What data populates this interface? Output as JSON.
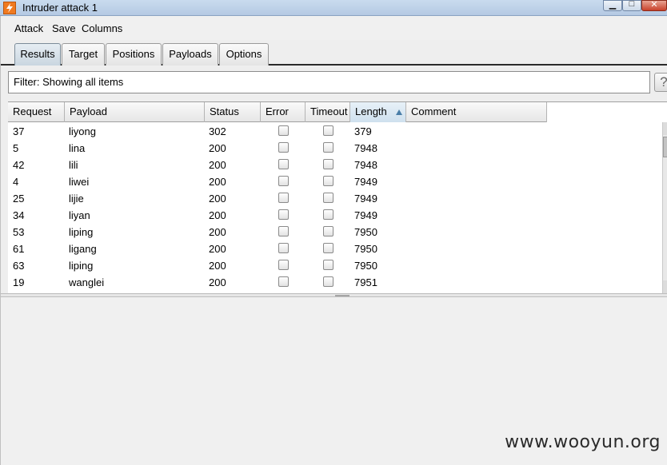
{
  "window": {
    "title": "Intruder attack 1",
    "icon": "burp-lightning-icon",
    "controls": [
      "minimize",
      "maximize",
      "close"
    ]
  },
  "menu": [
    "Attack",
    "Save",
    "Columns"
  ],
  "tabs": [
    {
      "label": "Results",
      "active": true
    },
    {
      "label": "Target",
      "active": false
    },
    {
      "label": "Positions",
      "active": false
    },
    {
      "label": "Payloads",
      "active": false
    },
    {
      "label": "Options",
      "active": false
    }
  ],
  "filter": {
    "text": "Filter: Showing all items",
    "help": "?"
  },
  "table": {
    "columns": [
      "Request",
      "Payload",
      "Status",
      "Error",
      "Timeout",
      "Length",
      "Comment"
    ],
    "sorted_column": "Length",
    "sort_direction": "ascending",
    "rows": [
      {
        "request": "37",
        "payload": "liyong",
        "status": "302",
        "error": false,
        "timeout": false,
        "length": "379",
        "comment": ""
      },
      {
        "request": "5",
        "payload": "lina",
        "status": "200",
        "error": false,
        "timeout": false,
        "length": "7948",
        "comment": ""
      },
      {
        "request": "42",
        "payload": "lili",
        "status": "200",
        "error": false,
        "timeout": false,
        "length": "7948",
        "comment": ""
      },
      {
        "request": "4",
        "payload": "liwei",
        "status": "200",
        "error": false,
        "timeout": false,
        "length": "7949",
        "comment": ""
      },
      {
        "request": "25",
        "payload": "lijie",
        "status": "200",
        "error": false,
        "timeout": false,
        "length": "7949",
        "comment": ""
      },
      {
        "request": "34",
        "payload": "liyan",
        "status": "200",
        "error": false,
        "timeout": false,
        "length": "7949",
        "comment": ""
      },
      {
        "request": "53",
        "payload": "liping",
        "status": "200",
        "error": false,
        "timeout": false,
        "length": "7950",
        "comment": ""
      },
      {
        "request": "61",
        "payload": "ligang",
        "status": "200",
        "error": false,
        "timeout": false,
        "length": "7950",
        "comment": ""
      },
      {
        "request": "63",
        "payload": "liping",
        "status": "200",
        "error": false,
        "timeout": false,
        "length": "7950",
        "comment": ""
      },
      {
        "request": "19",
        "payload": "wanglei",
        "status": "200",
        "error": false,
        "timeout": false,
        "length": "7951",
        "comment": ""
      }
    ]
  },
  "watermark": "www.wooyun.org"
}
